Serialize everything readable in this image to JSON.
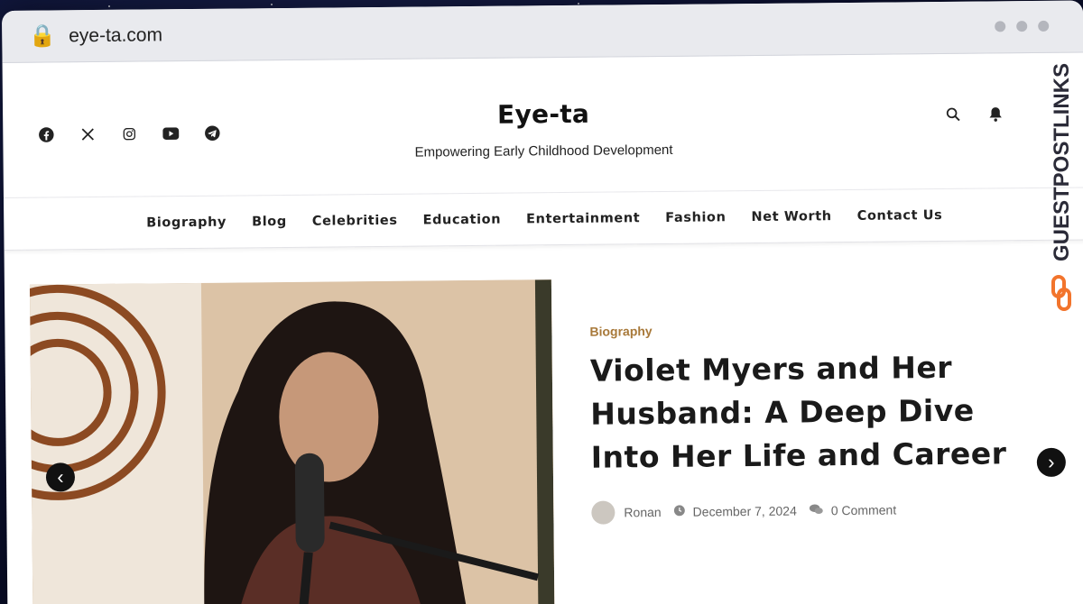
{
  "browser": {
    "url": "eye-ta.com"
  },
  "site": {
    "title": "Eye-ta",
    "tagline": "Empowering Early Childhood Development",
    "social_icons": [
      "facebook-icon",
      "x-icon",
      "instagram-icon",
      "youtube-icon",
      "telegram-icon"
    ],
    "tool_icons": [
      "search-icon",
      "bell-icon"
    ]
  },
  "nav": {
    "items": [
      {
        "label": "Biography"
      },
      {
        "label": "Blog"
      },
      {
        "label": "Celebrities"
      },
      {
        "label": "Education"
      },
      {
        "label": "Entertainment"
      },
      {
        "label": "Fashion"
      },
      {
        "label": "Net Worth"
      },
      {
        "label": "Contact Us"
      }
    ]
  },
  "featured": {
    "category": "Biography",
    "title": "Violet Myers and Her Husband: A Deep Dive Into Her Life and Career",
    "author": "Ronan",
    "date": "December 7, 2024",
    "comments": "0 Comment"
  },
  "watermark": {
    "text": "GUESTPOSTLINKS"
  },
  "colors": {
    "category": "#a8793a",
    "text": "#1a1a1a",
    "accent_orange": "#f2742c"
  }
}
